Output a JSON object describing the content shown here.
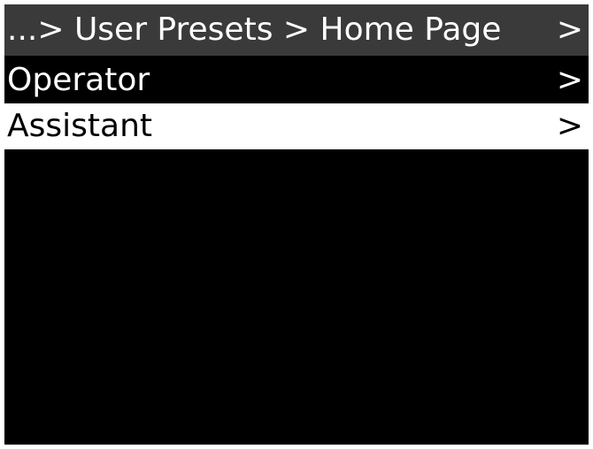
{
  "header": {
    "breadcrumb": "...> User Presets > Home Page",
    "chevron": ">"
  },
  "menu": {
    "items": [
      {
        "label": "Operator",
        "chevron": ">",
        "selected": false
      },
      {
        "label": "Assistant",
        "chevron": ">",
        "selected": true
      }
    ]
  },
  "colors": {
    "background": "#000000",
    "header_background": "#3a3a3a",
    "text": "#ffffff",
    "selected_background": "#ffffff",
    "selected_text": "#000000"
  }
}
